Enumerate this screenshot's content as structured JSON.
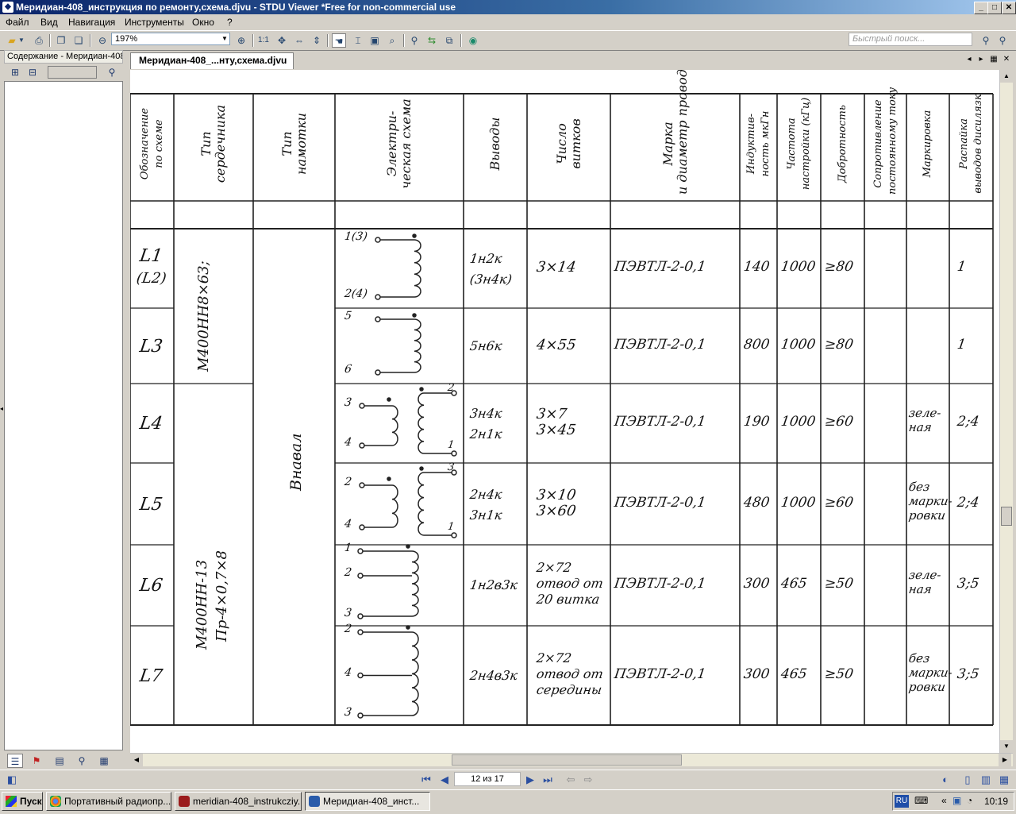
{
  "window": {
    "title": "Меридиан-408_инструкция по ремонту,схема.djvu - STDU Viewer *Free for non-commercial use",
    "controls": [
      "_",
      "□",
      "✕"
    ]
  },
  "menu": [
    "Файл",
    "Вид",
    "Навигация",
    "Инструменты",
    "Окно",
    "?"
  ],
  "toolbar": {
    "zoom": "197%",
    "page_ratio": "1:1",
    "quick_search_placeholder": "Быстрый поиск..."
  },
  "left_panel": {
    "title": "Содержание - Меридиан-408"
  },
  "document_tab": {
    "label": "Меридиан-408_...нту,схема.djvu"
  },
  "status": {
    "page": "12 из 17"
  },
  "taskbar": {
    "start": "Пуск",
    "tasks": [
      {
        "label": "Портативный радиопр...",
        "color": "#dd4b39"
      },
      {
        "label": "meridian-408_instrukcziy...",
        "color": "#9b1c1c"
      },
      {
        "label": "Меридиан-408_инст...",
        "color": "#2a5caa"
      }
    ],
    "lang": "RU",
    "time": "10:19"
  },
  "table": {
    "headers": [
      "Обозначение по схеме",
      "Тип сердечника",
      "Тип намотки",
      "Электри- ческая схема",
      "Выводы",
      "Число витков",
      "Марка и диаметр провода",
      "Индуктив- ность мкГн",
      "Частота настройки (кГц)",
      "Добротность",
      "Сопротивление постоянному току",
      "Маркировка",
      "Распайка выводов дисилязк"
    ],
    "core_l1_l3": "М400НН8×63;",
    "core_l4_l7": "М400НН-13 Пр-4×0,7×8",
    "winding": "Внавал",
    "rows": [
      {
        "id": "L1",
        "id2": "(L2)",
        "leads": [
          "1н2к",
          "(3н4к)"
        ],
        "turns": [
          "3×14"
        ],
        "wire": "ПЭВТЛ-2-0,1",
        "ind": "140",
        "freq": "1000",
        "q": "≥80",
        "mark": "",
        "pin": "1",
        "pins": [
          "1(3)",
          "2(4)"
        ]
      },
      {
        "id": "L3",
        "id2": "",
        "leads": [
          "5н6к"
        ],
        "turns": [
          "4×55"
        ],
        "wire": "ПЭВТЛ-2-0,1",
        "ind": "800",
        "freq": "1000",
        "q": "≥80",
        "mark": "",
        "pin": "1",
        "pins": [
          "5",
          "6"
        ]
      },
      {
        "id": "L4",
        "id2": "",
        "leads": [
          "3н4к",
          "2н1к"
        ],
        "turns": [
          "3×7",
          "3×45"
        ],
        "wire": "ПЭВТЛ-2-0,1",
        "ind": "190",
        "freq": "1000",
        "q": "≥60",
        "mark": "зеле- ная",
        "pin": "2;4",
        "pins": [
          "3",
          "4",
          "2",
          "1"
        ]
      },
      {
        "id": "L5",
        "id2": "",
        "leads": [
          "2н4к",
          "3н1к"
        ],
        "turns": [
          "3×10",
          "3×60"
        ],
        "wire": "ПЭВТЛ-2-0,1",
        "ind": "480",
        "freq": "1000",
        "q": "≥60",
        "mark": "без марки- ровки",
        "pin": "2;4",
        "pins": [
          "2",
          "4",
          "3",
          "1"
        ]
      },
      {
        "id": "L6",
        "id2": "",
        "leads": [
          "1н2в3к"
        ],
        "turns": [
          "2×72",
          "отвод от",
          "20 витка"
        ],
        "wire": "ПЭВТЛ-2-0,1",
        "ind": "300",
        "freq": "465",
        "q": "≥50",
        "mark": "зеле- ная",
        "pin": "3;5",
        "pins": [
          "1",
          "2",
          "3"
        ]
      },
      {
        "id": "L7",
        "id2": "",
        "leads": [
          "2н4в3к"
        ],
        "turns": [
          "2×72",
          "отвод от",
          "середины"
        ],
        "wire": "ПЭВТЛ-2-0,1",
        "ind": "300",
        "freq": "465",
        "q": "≥50",
        "mark": "без марки- ровки",
        "pin": "3;5",
        "pins": [
          "2",
          "4",
          "3"
        ]
      }
    ]
  }
}
